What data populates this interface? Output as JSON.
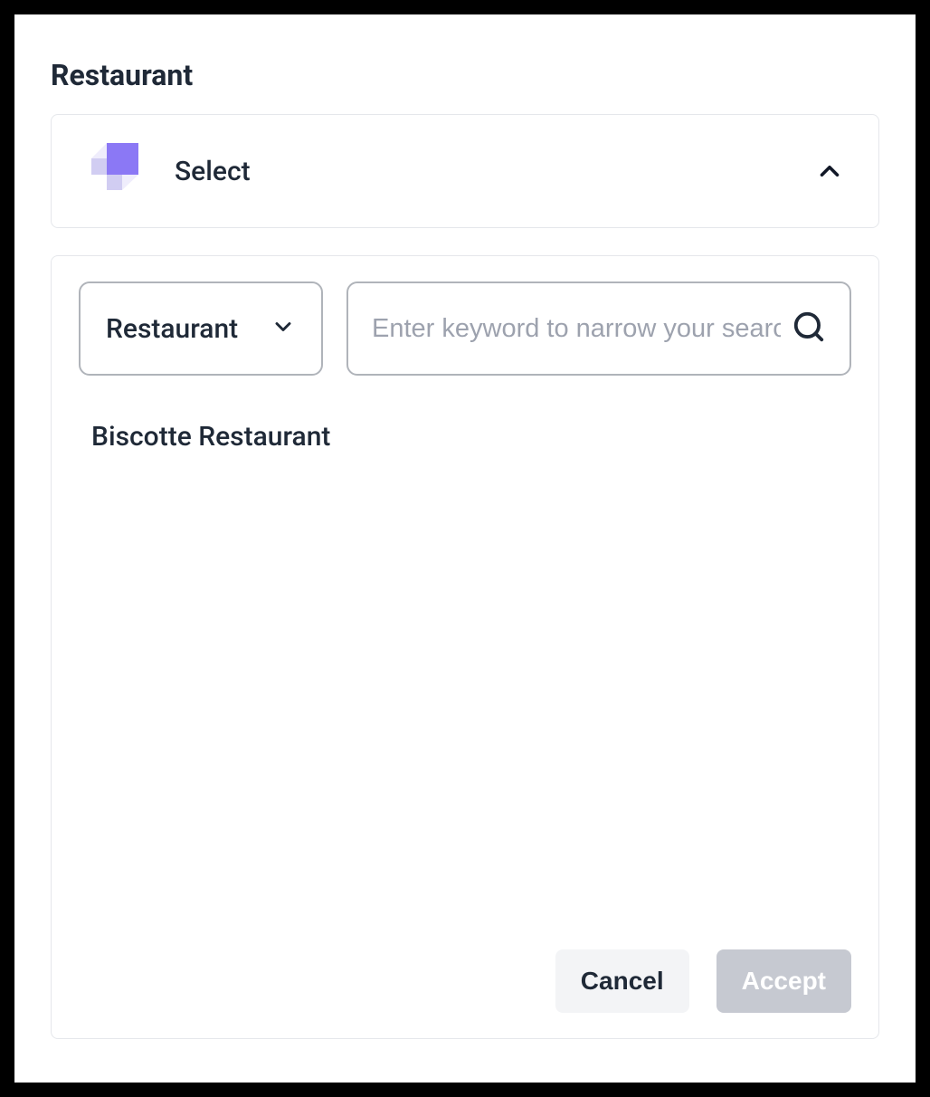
{
  "section_title": "Restaurant",
  "select": {
    "label": "Select"
  },
  "filter": {
    "type_label": "Restaurant",
    "search_placeholder": "Enter keyword to narrow your search"
  },
  "results": [
    "Biscotte Restaurant"
  ],
  "actions": {
    "cancel_label": "Cancel",
    "accept_label": "Accept"
  },
  "colors": {
    "accent": "#8b78f5",
    "accent_light": "#d1cdf2",
    "border": "#e5e7eb",
    "text": "#1f2937",
    "placeholder": "#9da2ae",
    "btn_cancel_bg": "#f3f4f6",
    "btn_accept_bg": "#c6c9d1"
  }
}
